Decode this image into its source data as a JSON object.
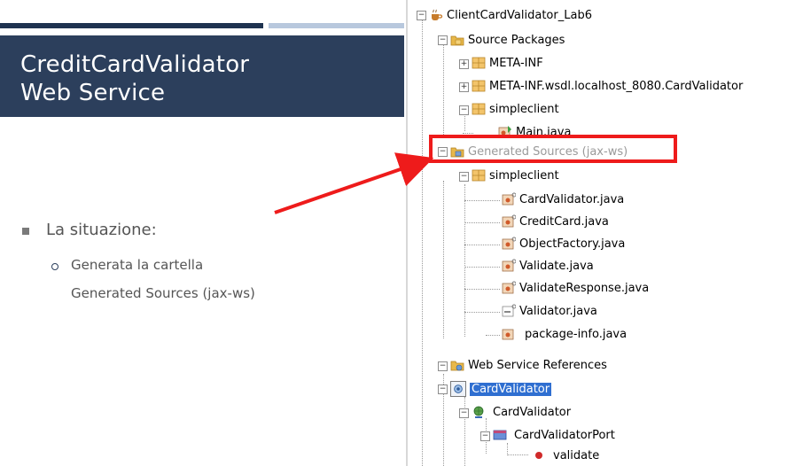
{
  "slide": {
    "title_line1": "CreditCardValidator",
    "title_line2": "Web Service",
    "bullet": "La situazione:",
    "sub_bullet_line1": "Generata la cartella",
    "sub_bullet_line2": "Generated Sources (jax-ws)"
  },
  "tree": {
    "project": "ClientCardValidator_Lab6",
    "source_packages": "Source Packages",
    "meta_inf": "META-INF",
    "meta_inf_wsdl": "META-INF.wsdl.localhost_8080.CardValidator",
    "simpleclient": "simpleclient",
    "main_java": "Main.java",
    "generated_sources": "Generated Sources (jax-ws)",
    "gen_simpleclient": "simpleclient",
    "files": [
      "CardValidator.java",
      "CreditCard.java",
      "ObjectFactory.java",
      "Validate.java",
      "ValidateResponse.java",
      "Validator.java",
      "package-info.java"
    ],
    "web_service_references": "Web Service References",
    "card_validator_ref": "CardValidator",
    "card_validator_service": "CardValidator",
    "card_validator_port": "CardValidatorPort",
    "validate_op": "validate"
  },
  "colors": {
    "title_bg": "#2c3f5c",
    "highlight": "#ee1b1b",
    "selection": "#2f6fd1"
  }
}
